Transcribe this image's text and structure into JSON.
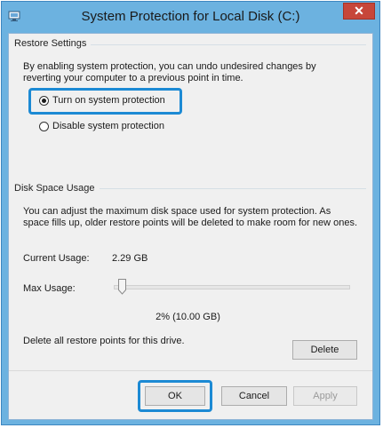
{
  "window": {
    "title": "System Protection for Local Disk (C:)",
    "close_label": "✕"
  },
  "restore_settings": {
    "group_label": "Restore Settings",
    "description": "By enabling system protection, you can undo undesired changes by reverting your computer to a previous point in time.",
    "options": [
      {
        "label": "Turn on system protection",
        "selected": true
      },
      {
        "label": "Disable system protection",
        "selected": false
      }
    ]
  },
  "disk_space": {
    "group_label": "Disk Space Usage",
    "description": "You can adjust the maximum disk space used for system protection. As space fills up, older restore points will be deleted to make room for new ones.",
    "current_usage_label": "Current Usage:",
    "current_usage_value": "2.29 GB",
    "max_usage_label": "Max Usage:",
    "max_usage_value": "2% (10.00 GB)",
    "max_usage_fraction": 0.02,
    "delete_text": "Delete all restore points for this drive.",
    "delete_button": "Delete"
  },
  "buttons": {
    "ok": "OK",
    "cancel": "Cancel",
    "apply": "Apply"
  },
  "colors": {
    "title_bar": "#6cb2e0",
    "highlight": "#1c8ad4",
    "close_button": "#c7463a"
  }
}
